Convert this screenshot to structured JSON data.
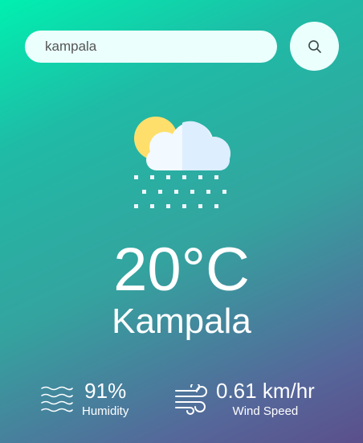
{
  "search": {
    "value": "kampala",
    "button_icon": "search-icon"
  },
  "weather": {
    "icon": "cloud-sun-snow-icon",
    "temperature": "20°C",
    "city": "Kampala"
  },
  "details": {
    "humidity": {
      "icon": "humidity-waves-icon",
      "value": "91%",
      "label": "Humidity"
    },
    "wind": {
      "icon": "wind-icon",
      "value": "0.61 km/hr",
      "label": "Wind Speed"
    }
  },
  "colors": {
    "gradient_start": "#00f0b0",
    "gradient_end": "#5b4f8b",
    "field_background": "#ebfffc",
    "text": "#ffffff"
  }
}
